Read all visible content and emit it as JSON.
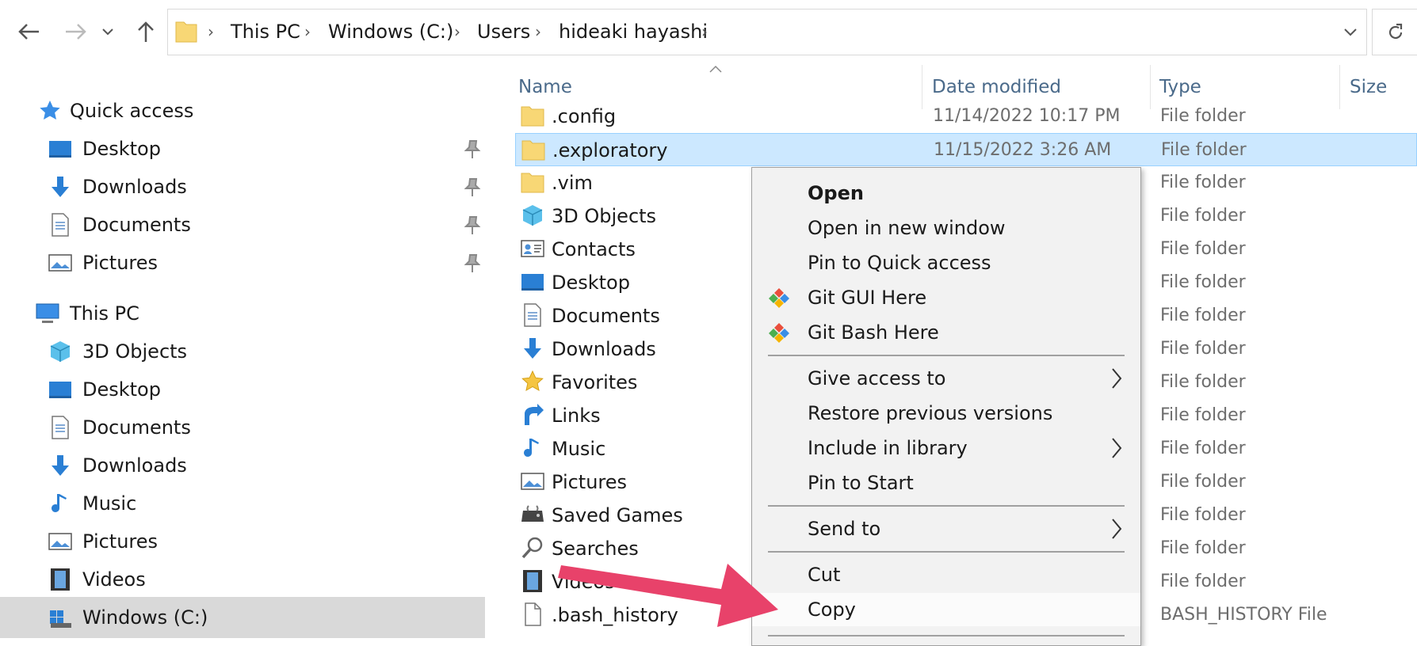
{
  "address": {
    "breadcrumbs": [
      "This PC",
      "Windows (C:)",
      "Users",
      "hideaki hayashi"
    ]
  },
  "nav": {
    "quick_access_label": "Quick access",
    "quick_items": [
      "Desktop",
      "Downloads",
      "Documents",
      "Pictures"
    ],
    "this_pc_label": "This PC",
    "pc_items": [
      "3D Objects",
      "Desktop",
      "Documents",
      "Downloads",
      "Music",
      "Pictures",
      "Videos",
      "Windows (C:)"
    ]
  },
  "columns": {
    "name": "Name",
    "date": "Date modified",
    "type": "Type",
    "size": "Size"
  },
  "files": [
    {
      "name": ".config",
      "date": "11/14/2022 10:17 PM",
      "type": "File folder",
      "icon": "folder-icon"
    },
    {
      "name": ".exploratory",
      "date": "11/15/2022 3:26 AM",
      "type": "File folder",
      "icon": "folder-icon"
    },
    {
      "name": ".vim",
      "date": "",
      "type": "File folder",
      "icon": "folder-icon"
    },
    {
      "name": "3D Objects",
      "date": "",
      "type": "File folder",
      "icon": "3d-objects-icon"
    },
    {
      "name": "Contacts",
      "date": "",
      "type": "File folder",
      "icon": "contacts-icon"
    },
    {
      "name": "Desktop",
      "date": "",
      "type": "File folder",
      "icon": "desktop-icon"
    },
    {
      "name": "Documents",
      "date": "",
      "type": "File folder",
      "icon": "documents-icon"
    },
    {
      "name": "Downloads",
      "date": "",
      "type": "File folder",
      "icon": "downloads-icon"
    },
    {
      "name": "Favorites",
      "date": "",
      "type": "File folder",
      "icon": "favorites-star-icon"
    },
    {
      "name": "Links",
      "date": "",
      "type": "File folder",
      "icon": "links-icon"
    },
    {
      "name": "Music",
      "date": "",
      "type": "File folder",
      "icon": "music-note-icon"
    },
    {
      "name": "Pictures",
      "date": "",
      "type": "File folder",
      "icon": "pictures-icon"
    },
    {
      "name": "Saved Games",
      "date": "",
      "type": "File folder",
      "icon": "saved-games-icon"
    },
    {
      "name": "Searches",
      "date": "",
      "type": "File folder",
      "icon": "searches-icon"
    },
    {
      "name": "Videos",
      "date": "",
      "type": "File folder",
      "icon": "videos-icon"
    },
    {
      "name": ".bash_history",
      "date": "",
      "type": "BASH_HISTORY File",
      "icon": "file-icon"
    }
  ],
  "context_menu": {
    "open": "Open",
    "open_new_window": "Open in new window",
    "pin_quick_access": "Pin to Quick access",
    "git_gui": "Git GUI Here",
    "git_bash": "Git Bash Here",
    "give_access": "Give access to",
    "restore_versions": "Restore previous versions",
    "include_library": "Include in library",
    "pin_start": "Pin to Start",
    "send_to": "Send to",
    "cut": "Cut",
    "copy": "Copy"
  },
  "colors": {
    "selection": "#cce8ff",
    "folder": "#f8d775",
    "accent_arrow": "#e8426a",
    "header_text": "#4a6a8a"
  }
}
